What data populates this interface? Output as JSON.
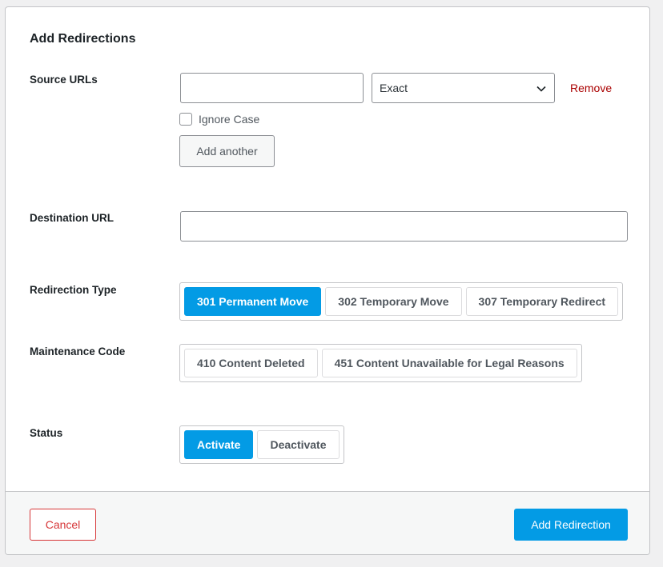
{
  "form": {
    "title": "Add Redirections",
    "source": {
      "label": "Source URLs",
      "url_value": "",
      "match_selected": "Exact",
      "remove_label": "Remove",
      "ignore_case_label": "Ignore Case",
      "ignore_case_checked": false,
      "add_another_label": "Add another"
    },
    "destination": {
      "label": "Destination URL",
      "value": ""
    },
    "redirection_type": {
      "label": "Redirection Type",
      "options": [
        "301 Permanent Move",
        "302 Temporary Move",
        "307 Temporary Redirect"
      ],
      "selected": "301 Permanent Move"
    },
    "maintenance_code": {
      "label": "Maintenance Code",
      "options": [
        "410 Content Deleted",
        "451 Content Unavailable for Legal Reasons"
      ],
      "selected": ""
    },
    "status": {
      "label": "Status",
      "options": [
        "Activate",
        "Deactivate"
      ],
      "selected": "Activate"
    }
  },
  "footer": {
    "cancel_label": "Cancel",
    "submit_label": "Add Redirection"
  },
  "colors": {
    "accent": "#039be5",
    "danger": "#d63638",
    "remove_link": "#aa0000"
  },
  "icons": {
    "select_arrow": "chevron-down-icon"
  }
}
